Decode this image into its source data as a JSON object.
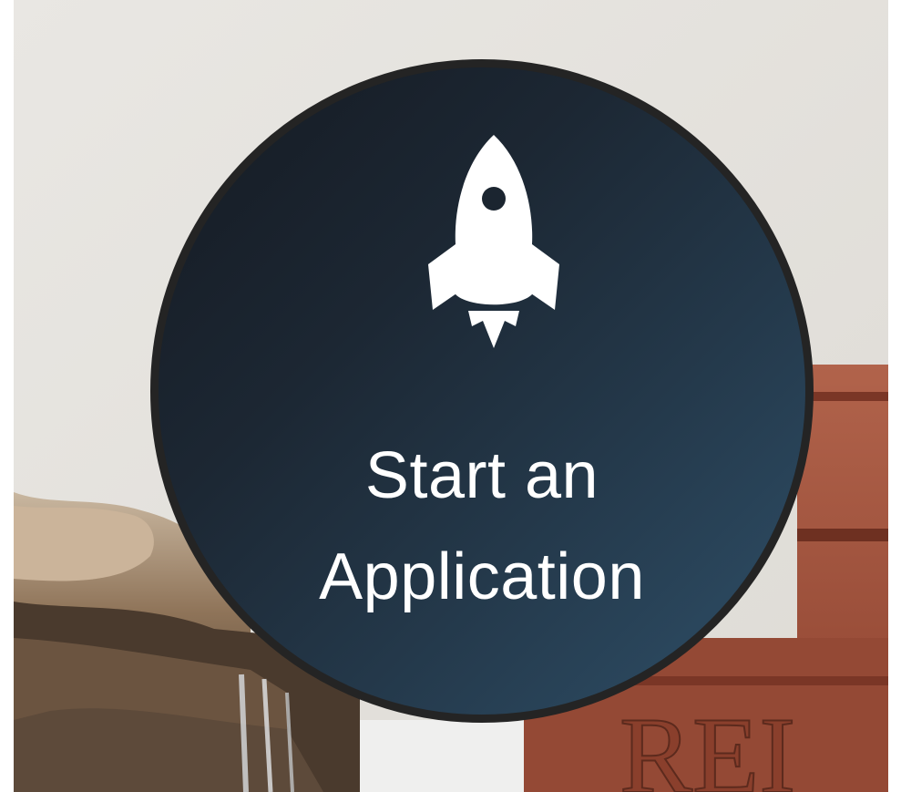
{
  "cta": {
    "icon": "rocket-icon",
    "label_line1": "Start an",
    "label_line2": "Application"
  },
  "background": {
    "engraved_text": "REI"
  },
  "colors": {
    "circle_border": "#242424",
    "circle_gradient_start": "#151a22",
    "circle_gradient_end": "#2f5069",
    "label": "#ffffff",
    "wall": "#e6e3dd",
    "brick": "#9a4a35"
  }
}
